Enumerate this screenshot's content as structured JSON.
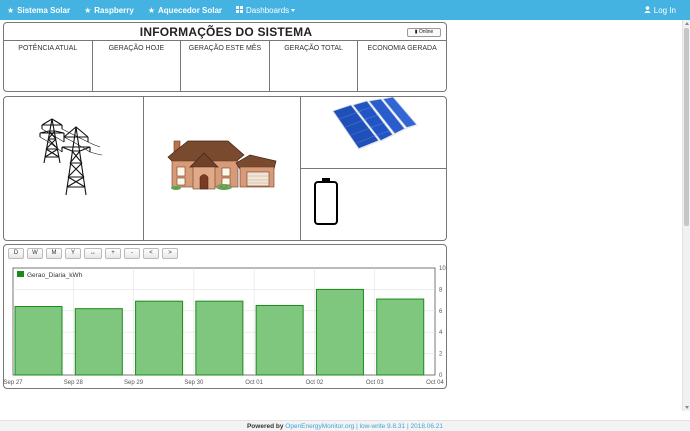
{
  "navbar": {
    "items": [
      {
        "label": "Sistema Solar",
        "icon": "star-icon"
      },
      {
        "label": "Raspberry",
        "icon": "star-icon"
      },
      {
        "label": "Aquecedor Solar",
        "icon": "star-icon"
      },
      {
        "label": "Dashboards",
        "icon": "grid-icon"
      }
    ],
    "login": "Log In",
    "color": "#44b3e2"
  },
  "info": {
    "title": "INFORMAÇÕES DO SISTEMA",
    "status": "Online",
    "columns": [
      "POTÊNCIA ATUAL",
      "GERAÇÃO HOJE",
      "GERAÇÃO ESTE MÊS",
      "GERAÇÃO TOTAL",
      "ECONOMIA GERADA"
    ]
  },
  "chart_controls": [
    "D",
    "W",
    "M",
    "Y",
    "↔",
    "+",
    "-",
    "<",
    ">"
  ],
  "chart_data": {
    "type": "bar",
    "series": [
      {
        "name": "Gerao_Diaria_kWh",
        "color": "#1a8a1a",
        "fill": "#7fc77f",
        "x": [
          "Sep 27",
          "Sep 28",
          "Sep 29",
          "Sep 30",
          "Oct 01",
          "Oct 02",
          "Oct 03"
        ],
        "values": [
          6.4,
          6.2,
          6.9,
          6.9,
          6.5,
          8.0,
          7.1
        ]
      }
    ],
    "x_ticks": [
      "Sep 27",
      "Sep 28",
      "Sep 29",
      "Sep 30",
      "Oct 01",
      "Oct 02",
      "Oct 03",
      "Oct 04"
    ],
    "ylim": [
      0,
      10
    ],
    "y_ticks": [
      0,
      2,
      4,
      6,
      8,
      10
    ],
    "y_axis_side": "right",
    "grid": true,
    "legend_position": "top-left"
  },
  "footer": {
    "powered": "Powered by",
    "link": "OpenEnergyMonitor.org",
    "sep1": "|",
    "version": "low-write 9.8.31",
    "sep2": "|",
    "date": "2018.06.21"
  }
}
